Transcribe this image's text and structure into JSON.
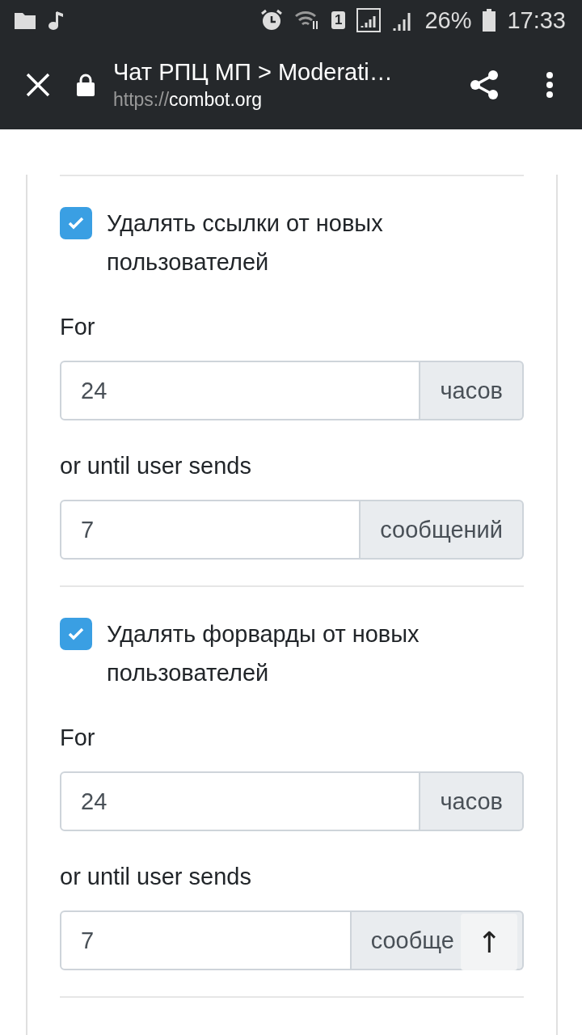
{
  "status_bar": {
    "sim": "1",
    "battery": "26%",
    "time": "17:33"
  },
  "toolbar": {
    "title": "Чат РПЦ МП > Moderati…",
    "url_scheme": "https://",
    "url_host": "combot.org"
  },
  "sections": [
    {
      "label": "Удалять ссылки от новых пользователей",
      "checked": true,
      "fields": [
        {
          "label": "For",
          "value": "24",
          "unit": "часов"
        },
        {
          "label": "or until user sends",
          "value": "7",
          "unit": "сообщений"
        }
      ]
    },
    {
      "label": "Удалять форварды от новых пользователей",
      "checked": true,
      "fields": [
        {
          "label": "For",
          "value": "24",
          "unit": "часов"
        },
        {
          "label": "or until user sends",
          "value": "7",
          "unit": "сообще"
        }
      ]
    }
  ],
  "scroll_top": {
    "label": "↑"
  }
}
